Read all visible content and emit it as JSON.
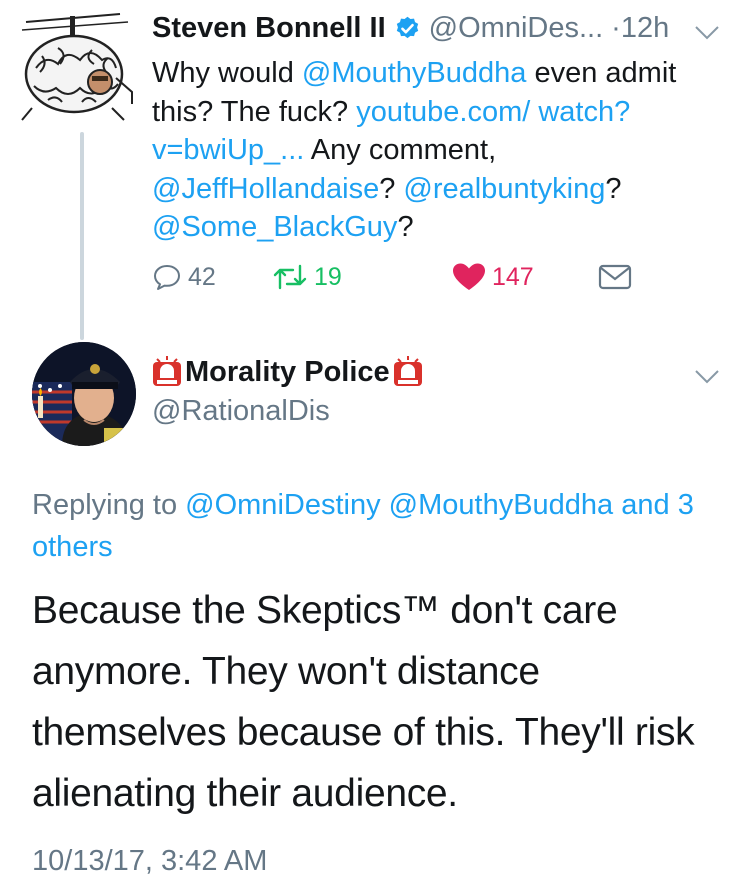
{
  "colors": {
    "link": "#1da1f2",
    "muted": "#657786",
    "retweet": "#17bf63",
    "like": "#e0245e",
    "verified": "#1da1f2",
    "thread_line": "#ccd6dd"
  },
  "tweet1": {
    "display_name": "Steven Bonnell II",
    "verified_icon": "verified-badge-icon",
    "handle": "@OmniDes...",
    "time_separator": "·",
    "time": "12h",
    "menu_icon": "chevron-down-icon",
    "body": {
      "line1_text": "Why would ",
      "mention_buddha": "@MouthyBuddha",
      "line1_end": " even admit this? The fuck? ",
      "link": "youtube.com/ watch?v=bwiUp_...",
      "after_link": " Any comment, ",
      "mention_jeff": "@JeffHollandaise",
      "q1": "? ",
      "mention_bunty": "@realbuntyking",
      "q2": "? ",
      "mention_some": "@Some_BlackGuy",
      "q3": "?"
    },
    "actions": {
      "reply_icon": "reply-icon",
      "reply_count": "42",
      "retweet_icon": "retweet-icon",
      "retweet_count": "19",
      "like_icon": "heart-icon",
      "like_count": "147",
      "dm_icon": "envelope-icon"
    }
  },
  "tweet2": {
    "siren_icon": "siren-icon",
    "display_name": "Morality Police",
    "handle": "@RationalDis",
    "menu_icon": "chevron-down-icon",
    "replying_prefix": "Replying to ",
    "replying_mention1": "@OmniDestiny",
    "replying_mention2": "@MouthyBuddha",
    "replying_and": " and ",
    "replying_others": "3 others",
    "body": "Because the Skeptics™ don't care anymore. They won't distance themselves because of this. They'll risk alienating their audience.",
    "timestamp": "10/13/17, 3:42 AM"
  }
}
